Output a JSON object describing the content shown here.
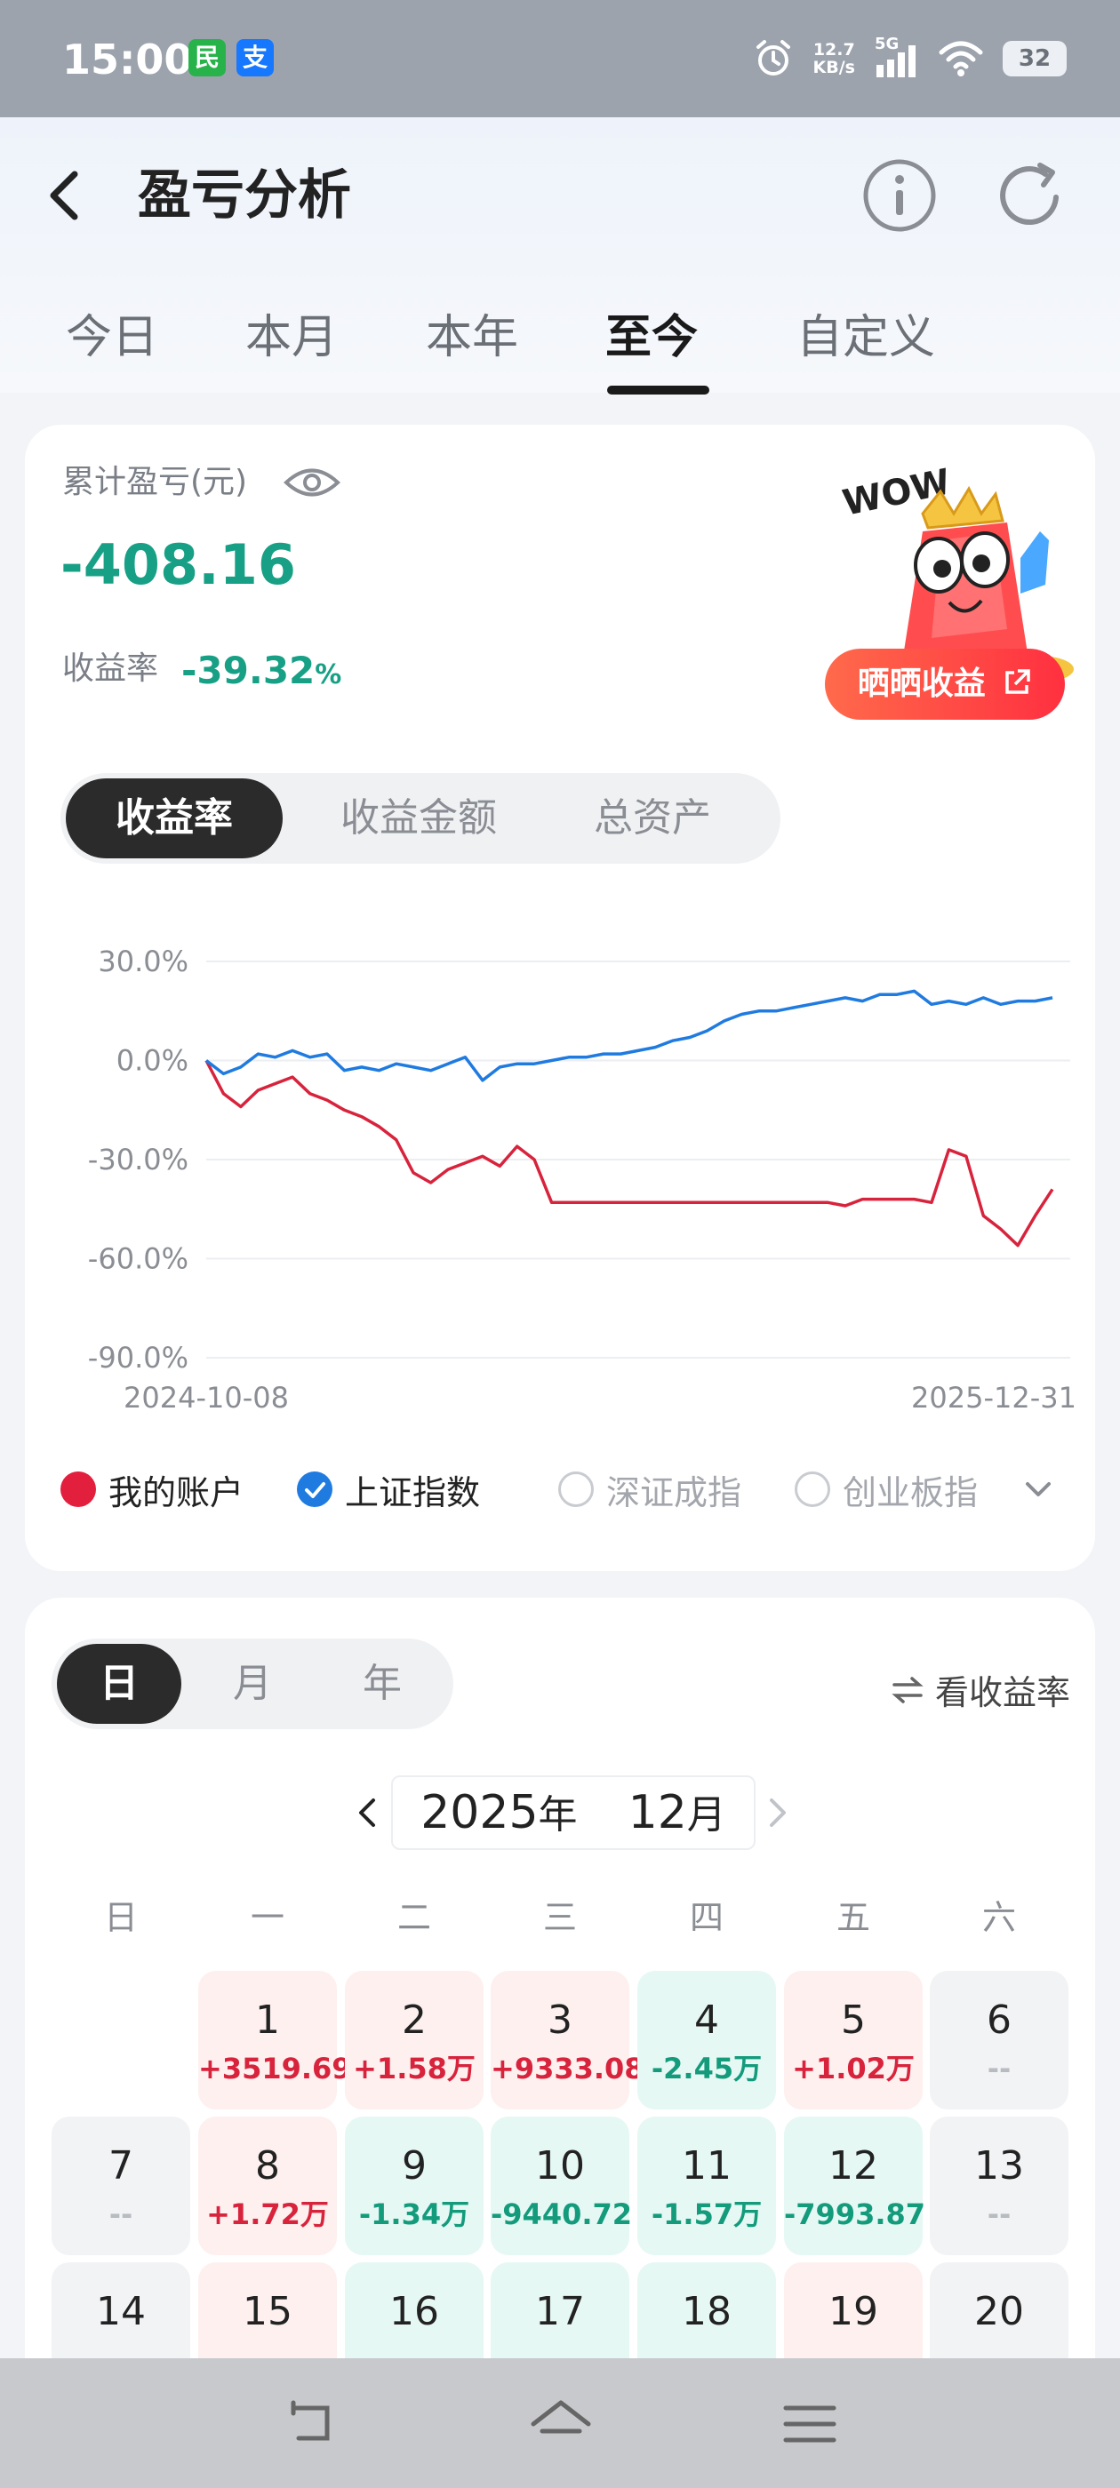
{
  "status_bar": {
    "time": "15:00",
    "app_badge_1": "民",
    "app_badge_2": "支",
    "net_speed_value": "12.7",
    "net_speed_unit": "KB/s",
    "network": "5G",
    "battery": "32"
  },
  "nav": {
    "title": "盈亏分析"
  },
  "tabs": [
    {
      "label": "今日",
      "active": false
    },
    {
      "label": "本月",
      "active": false
    },
    {
      "label": "本年",
      "active": false
    },
    {
      "label": "至今",
      "active": true
    },
    {
      "label": "自定义",
      "active": false
    }
  ],
  "summary": {
    "cum_label": "累计盈亏(元)",
    "cum_value": "-408.16",
    "rate_label": "收益率",
    "rate_value": "-39.32",
    "rate_unit": "%",
    "promo_wow": "WOW",
    "promo_button": "晒晒收益"
  },
  "segments": [
    {
      "label": "收益率",
      "active": true
    },
    {
      "label": "收益金额",
      "active": false
    },
    {
      "label": "总资产",
      "active": false
    }
  ],
  "chart_data": {
    "type": "line",
    "x_start": "2024-10-08",
    "x_end": "2025-12-31",
    "ylim": [
      -90,
      30
    ],
    "yticks": [
      "30.0%",
      "0.0%",
      "-30.0%",
      "-60.0%",
      "-90.0%"
    ],
    "ytick_values": [
      30,
      0,
      -30,
      -60,
      -90
    ],
    "grid": true,
    "series": [
      {
        "name": "我的账户",
        "color": "#d8233c",
        "values": [
          0,
          -10,
          -14,
          -9,
          -7,
          -5,
          -10,
          -12,
          -15,
          -17,
          -20,
          -24,
          -34,
          -37,
          -33,
          -31,
          -29,
          -32,
          -26,
          -30,
          -43,
          -43,
          -43,
          -43,
          -43,
          -43,
          -43,
          -43,
          -43,
          -43,
          -43,
          -43,
          -43,
          -43,
          -43,
          -43,
          -43,
          -44,
          -42,
          -42,
          -42,
          -42,
          -43,
          -27,
          -29,
          -47,
          -51,
          -56,
          -47,
          -39
        ]
      },
      {
        "name": "上证指数",
        "color": "#1f7be0",
        "values": [
          0,
          -4,
          -2,
          2,
          1,
          3,
          1,
          2,
          -3,
          -2,
          -3,
          -1,
          -2,
          -3,
          -1,
          1,
          -6,
          -2,
          -1,
          -1,
          0,
          1,
          1,
          2,
          2,
          3,
          4,
          6,
          7,
          9,
          12,
          14,
          15,
          15,
          16,
          17,
          18,
          19,
          18,
          20,
          20,
          21,
          17,
          18,
          17,
          19,
          17,
          18,
          18,
          19
        ]
      }
    ]
  },
  "legend": {
    "items": [
      {
        "label": "我的账户",
        "state": "on-red"
      },
      {
        "label": "上证指数",
        "state": "on-blue"
      },
      {
        "label": "深证成指",
        "state": "off"
      },
      {
        "label": "创业板指",
        "state": "off"
      }
    ]
  },
  "calendar": {
    "dmy_tabs": [
      {
        "label": "日",
        "active": true
      },
      {
        "label": "月",
        "active": false
      },
      {
        "label": "年",
        "active": false
      }
    ],
    "view_toggle": "看收益率",
    "year": "2025",
    "year_unit": "年",
    "month": "12",
    "month_unit": "月",
    "weekdays": [
      "日",
      "一",
      "二",
      "三",
      "四",
      "五",
      "六"
    ],
    "cells": [
      {
        "day": "1",
        "val": "+3519.69",
        "kind": "up"
      },
      {
        "day": "2",
        "val": "+1.58万",
        "kind": "up"
      },
      {
        "day": "3",
        "val": "+9333.08",
        "kind": "up"
      },
      {
        "day": "4",
        "val": "-2.45万",
        "kind": "down"
      },
      {
        "day": "5",
        "val": "+1.02万",
        "kind": "up"
      },
      {
        "day": "6",
        "val": "--",
        "kind": "none"
      },
      {
        "day": "7",
        "val": "--",
        "kind": "none"
      },
      {
        "day": "8",
        "val": "+1.72万",
        "kind": "up"
      },
      {
        "day": "9",
        "val": "-1.34万",
        "kind": "down"
      },
      {
        "day": "10",
        "val": "-9440.72",
        "kind": "down"
      },
      {
        "day": "11",
        "val": "-1.57万",
        "kind": "down"
      },
      {
        "day": "12",
        "val": "-7993.87",
        "kind": "down"
      },
      {
        "day": "13",
        "val": "--",
        "kind": "none"
      },
      {
        "day": "14",
        "val": "",
        "kind": "none"
      },
      {
        "day": "15",
        "val": "",
        "kind": "up"
      },
      {
        "day": "16",
        "val": "",
        "kind": "down"
      },
      {
        "day": "17",
        "val": "",
        "kind": "down"
      },
      {
        "day": "18",
        "val": "",
        "kind": "down"
      },
      {
        "day": "19",
        "val": "",
        "kind": "up"
      },
      {
        "day": "20",
        "val": "",
        "kind": "none"
      }
    ]
  }
}
